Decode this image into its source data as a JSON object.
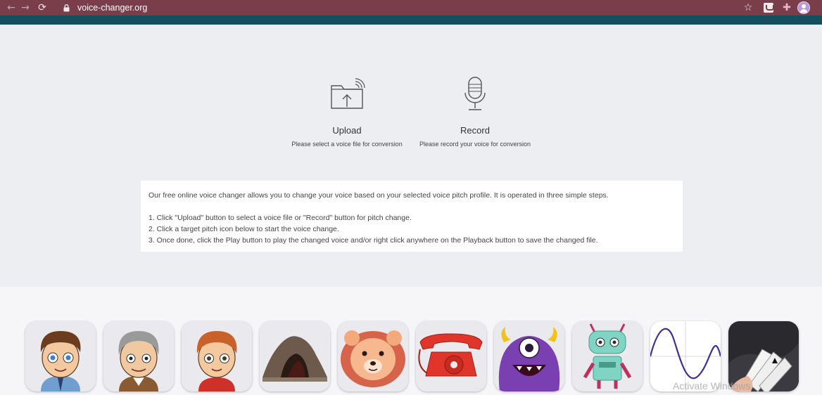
{
  "browser": {
    "url": "voice-changer.org"
  },
  "tools": {
    "upload": {
      "title": "Upload",
      "description": "Please select a voice file for conversion"
    },
    "record": {
      "title": "Record",
      "description": "Please record your voice for conversion"
    }
  },
  "info": {
    "intro": "Our free online voice changer allows you to change your voice based on your selected voice pitch profile. It is operated in three simple steps.",
    "steps": [
      "1. Click \"Upload\" button to select a voice file or \"Record\" button for pitch change.",
      "2. Click a target pitch icon below to start the voice change.",
      "3. Once done, click the Play button to play the changed voice and/or right click anywhere on the Playback button to save the changed file."
    ]
  },
  "pitches": [
    "boy",
    "old-man",
    "kid",
    "cave",
    "lion",
    "telephone",
    "monster",
    "robot",
    "sine-wave",
    "cards"
  ],
  "watermark": "Activate Windows",
  "colors": {
    "browser_bar": "#7a3d4a",
    "teal_strip": "#154e5c",
    "page_bg": "#eceef2"
  }
}
